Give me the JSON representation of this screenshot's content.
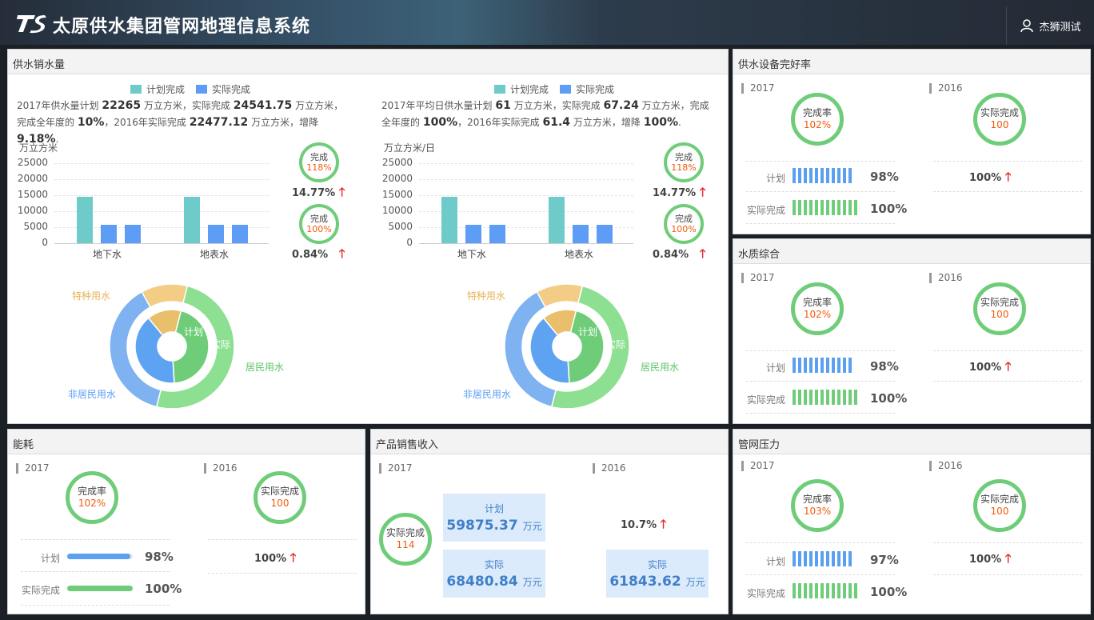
{
  "app": {
    "title": "太原供水集团管网地理信息系统",
    "user": "杰狮测试"
  },
  "supply": {
    "title": "供水销水量",
    "legend": [
      "计划完成",
      "实际完成"
    ],
    "colors": {
      "plan": "#6ecbc9",
      "actual": "#5d9df5"
    },
    "left": {
      "p1": "2017年供水量计划",
      "plan": "22265",
      "p2": "万立方米，实际完成",
      "actual": "24541.75",
      "p3": "万立方米，完",
      "p4": "成全年度的",
      "pct": "10%",
      "p5": "，2016年实际完成",
      "last": "22477.12",
      "p6": "万立方米，增降",
      "chg": "9.18%",
      "p7": ".",
      "unit": "万立方米",
      "ring1": {
        "label": "完成",
        "value": "118%",
        "pct": "14.77%"
      },
      "ring2": {
        "label": "完成",
        "value": "100%",
        "pct": "0.84%"
      }
    },
    "right": {
      "p1": "2017年平均日供水量计划",
      "plan": "61",
      "p2": "万立方米，实际完成",
      "actual": "67.24",
      "p3": "万立方米，完成全",
      "p4": "年度的",
      "pct": "100%",
      "p5": "，2016年实际完成",
      "last": "61.4",
      "p6": "万立方米，增降",
      "chg": "100%",
      "p7": ".",
      "unit": "万立方米/日",
      "ring1": {
        "label": "完成",
        "value": "118%",
        "pct": "14.77%"
      },
      "ring2": {
        "label": "完成",
        "value": "100%",
        "pct": "0.84%"
      }
    },
    "donut_labels": {
      "special": "特种用水",
      "resident": "居民用水",
      "nonres": "非居民用水",
      "plan": "计划",
      "actual": "实际"
    }
  },
  "chart_data": [
    {
      "type": "bar",
      "categories": [
        "地下水",
        "地表水"
      ],
      "ylabel": "万立方米",
      "ylim": [
        0,
        25000
      ],
      "yticks": [
        "25000",
        "20000",
        "15000",
        "10000",
        "5000",
        "0"
      ],
      "series": [
        {
          "name": "计划完成",
          "values": [
            14500,
            14500
          ]
        },
        {
          "name": "实际完成",
          "values": [
            5800,
            5800
          ]
        },
        {
          "name": "实际完成",
          "values": [
            5800,
            5800
          ]
        }
      ]
    },
    {
      "type": "bar",
      "categories": [
        "地下水",
        "地表水"
      ],
      "ylabel": "万立方米/日",
      "ylim": [
        0,
        25000
      ],
      "yticks": [
        "25000",
        "20000",
        "15000",
        "10000",
        "5000",
        "0"
      ],
      "series": [
        {
          "name": "计划完成",
          "values": [
            14500,
            14500
          ]
        },
        {
          "name": "实际完成",
          "values": [
            5800,
            5800
          ]
        },
        {
          "name": "实际完成",
          "values": [
            5800,
            5800
          ]
        }
      ]
    },
    {
      "type": "pie",
      "categories": [
        "居民用水",
        "非居民用水",
        "特种用水"
      ],
      "series": [
        {
          "name": "计划",
          "values": [
            45,
            40,
            15
          ]
        },
        {
          "name": "实际",
          "values": [
            50,
            38,
            12
          ]
        }
      ]
    },
    {
      "type": "pie",
      "categories": [
        "居民用水",
        "非居民用水",
        "特种用水"
      ],
      "series": [
        {
          "name": "计划",
          "values": [
            45,
            40,
            15
          ]
        },
        {
          "name": "实际",
          "values": [
            50,
            38,
            12
          ]
        }
      ]
    }
  ],
  "equip": {
    "title": "供水设备完好率",
    "y1": "2017",
    "y2": "2016",
    "r1l": "完成率",
    "r1v": "102%",
    "r2l": "实际完成",
    "r2v": "100",
    "planl": "计划",
    "planv": "98%",
    "actl": "实际完成",
    "actv": "100%",
    "pct": "100%"
  },
  "quality": {
    "title": "水质综合",
    "y1": "2017",
    "y2": "2016",
    "r1l": "完成率",
    "r1v": "102%",
    "r2l": "实际完成",
    "r2v": "100",
    "planl": "计划",
    "planv": "98%",
    "actl": "实际完成",
    "actv": "100%",
    "pct": "100%"
  },
  "energy": {
    "title": "能耗",
    "y1": "2017",
    "y2": "2016",
    "r1l": "完成率",
    "r1v": "102%",
    "r2l": "实际完成",
    "r2v": "100",
    "planl": "计划",
    "planv": "98%",
    "actl": "实际完成",
    "actv": "100%",
    "pct": "100%"
  },
  "sales": {
    "title": "产品销售收入",
    "y1": "2017",
    "y2": "2016",
    "rl": "实际完成",
    "rv": "114",
    "planl": "计划",
    "planv": "59875.37",
    "unit": "万元",
    "actl": "实际",
    "actv": "68480.84",
    "pct": "10.7%",
    "act16l": "实际",
    "act16v": "61843.62"
  },
  "pressure": {
    "title": "管网压力",
    "y1": "2017",
    "y2": "2016",
    "r1l": "完成率",
    "r1v": "103%",
    "r2l": "实际完成",
    "r2v": "100",
    "planl": "计划",
    "planv": "97%",
    "actl": "实际完成",
    "actv": "100%",
    "pct": "100%"
  },
  "icons": {
    "user": "user-icon",
    "up": "arrow-up-icon",
    "logo": "logo-icon"
  }
}
